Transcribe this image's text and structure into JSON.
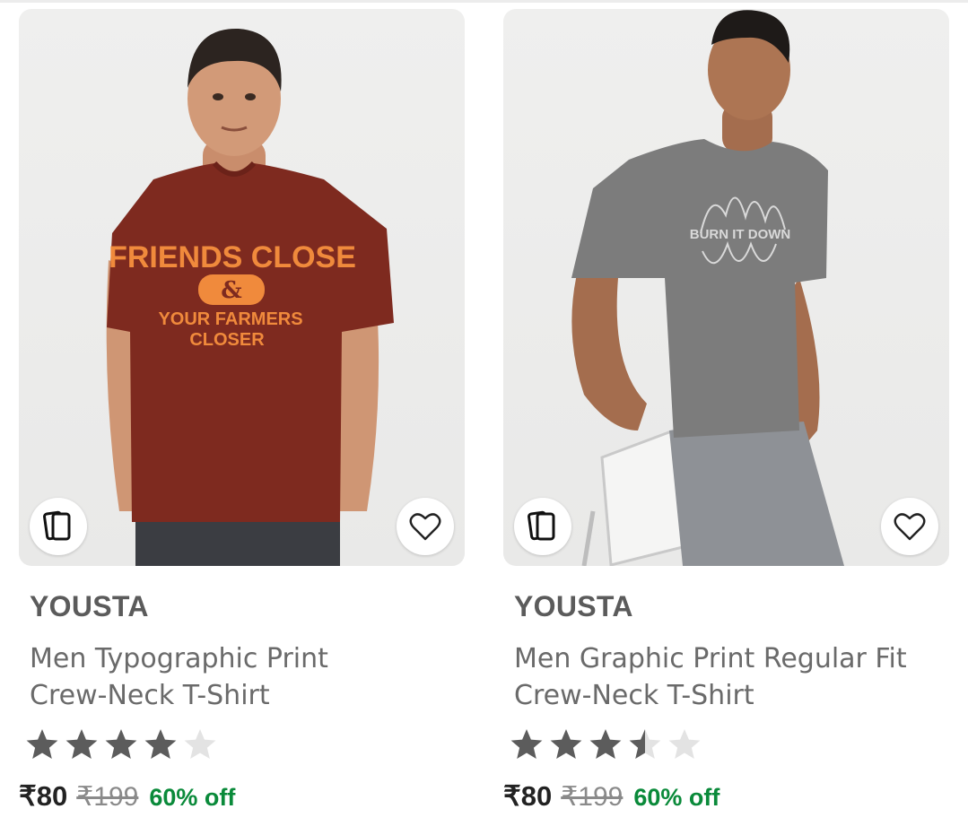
{
  "products": [
    {
      "brand": "YOUSTA",
      "title_line1": "Men Typographic Print",
      "title_line2": "Crew-Neck T-Shirt",
      "rating": 4,
      "rating_max": 5,
      "price": "₹80",
      "mrp": "₹199",
      "discount": "60% off",
      "tshirt_print": {
        "line1": "FRIENDS CLOSE",
        "amp": "&",
        "line2": "YOUR FARMERS",
        "line3": "CLOSER"
      },
      "shirt_color": "#7e2a1f",
      "print_color": "#f08a3c"
    },
    {
      "brand": "YOUSTA",
      "title_line1": "Men Graphic Print Regular Fit",
      "title_line2": "Crew-Neck T-Shirt",
      "rating": 3.5,
      "rating_max": 5,
      "price": "₹80",
      "mrp": "₹199",
      "discount": "60% off",
      "tshirt_print": {
        "line1": "BURN IT DOWN"
      },
      "shirt_color": "#7c7c7c",
      "print_color": "#d9d9d9"
    }
  ],
  "icons": {
    "compare": "compare-cards-icon",
    "wishlist": "heart-outline-icon",
    "star_filled": "star-filled-icon",
    "star_empty": "star-empty-icon"
  },
  "colors": {
    "star_filled": "#5c5c5c",
    "star_empty": "#e3e3e3",
    "discount": "#0a8a3a"
  }
}
